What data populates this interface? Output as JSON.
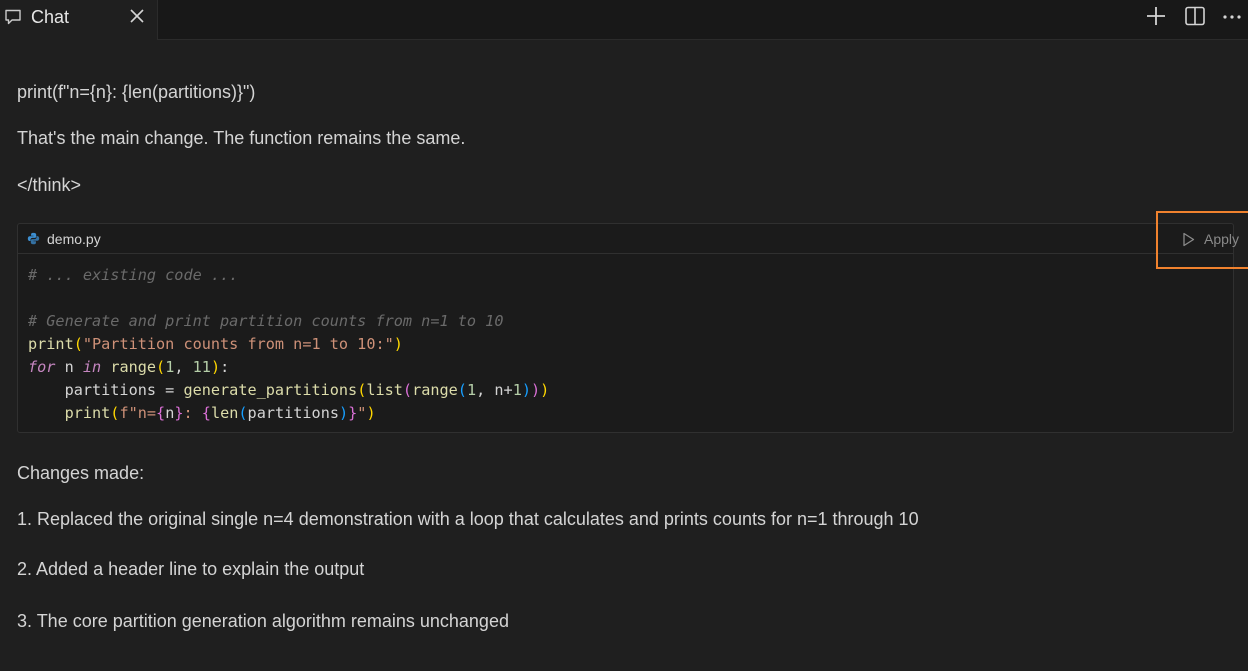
{
  "tab": {
    "label": "Chat"
  },
  "toolbar": {
    "icons": [
      "plus-icon",
      "split-editor-icon",
      "more-icon"
    ]
  },
  "message": {
    "line1": "print(f\"n={n}: {len(partitions)}\")",
    "line2": "That's the main change. The function remains the same.",
    "line3": "</think>",
    "changes_heading": "Changes made:",
    "changes": [
      "1. Replaced the original single n=4 demonstration with a loop that calculates and prints counts for n=1 through 10",
      "2. Added a header line to explain the output",
      "3. The core partition generation algorithm remains unchanged"
    ]
  },
  "codeblock": {
    "filename": "demo.py",
    "apply_label": "Apply",
    "lines": [
      {
        "tokens": [
          {
            "t": "# ... existing code ...",
            "c": "comment"
          }
        ]
      },
      {
        "tokens": []
      },
      {
        "tokens": [
          {
            "t": "# Generate and print partition counts from n=1 to 10",
            "c": "comment"
          }
        ]
      },
      {
        "tokens": [
          {
            "t": "print",
            "c": "fn"
          },
          {
            "t": "(",
            "c": "b1"
          },
          {
            "t": "\"Partition counts from n=1 to 10:\"",
            "c": "str"
          },
          {
            "t": ")",
            "c": "b1"
          }
        ]
      },
      {
        "tokens": [
          {
            "t": "for",
            "c": "kw"
          },
          {
            "t": " n ",
            "c": "plain"
          },
          {
            "t": "in",
            "c": "kw"
          },
          {
            "t": " ",
            "c": "plain"
          },
          {
            "t": "range",
            "c": "fn"
          },
          {
            "t": "(",
            "c": "b1"
          },
          {
            "t": "1",
            "c": "num"
          },
          {
            "t": ", ",
            "c": "plain"
          },
          {
            "t": "11",
            "c": "num"
          },
          {
            "t": ")",
            "c": "b1"
          },
          {
            "t": ":",
            "c": "plain"
          }
        ]
      },
      {
        "tokens": [
          {
            "t": "    partitions = ",
            "c": "plain"
          },
          {
            "t": "generate_partitions",
            "c": "fn"
          },
          {
            "t": "(",
            "c": "b1"
          },
          {
            "t": "list",
            "c": "fn"
          },
          {
            "t": "(",
            "c": "b2"
          },
          {
            "t": "range",
            "c": "fn"
          },
          {
            "t": "(",
            "c": "b3"
          },
          {
            "t": "1",
            "c": "num"
          },
          {
            "t": ", n+",
            "c": "plain"
          },
          {
            "t": "1",
            "c": "num"
          },
          {
            "t": ")",
            "c": "b3"
          },
          {
            "t": ")",
            "c": "b2"
          },
          {
            "t": ")",
            "c": "b1"
          }
        ]
      },
      {
        "tokens": [
          {
            "t": "    ",
            "c": "plain"
          },
          {
            "t": "print",
            "c": "fn"
          },
          {
            "t": "(",
            "c": "b1"
          },
          {
            "t": "f\"n=",
            "c": "str"
          },
          {
            "t": "{",
            "c": "b2"
          },
          {
            "t": "n",
            "c": "plain"
          },
          {
            "t": "}",
            "c": "b2"
          },
          {
            "t": ": ",
            "c": "str"
          },
          {
            "t": "{",
            "c": "b2"
          },
          {
            "t": "len",
            "c": "fn"
          },
          {
            "t": "(",
            "c": "b3"
          },
          {
            "t": "partitions",
            "c": "plain"
          },
          {
            "t": ")",
            "c": "b3"
          },
          {
            "t": "}",
            "c": "b2"
          },
          {
            "t": "\"",
            "c": "str"
          },
          {
            "t": ")",
            "c": "b1"
          }
        ]
      }
    ]
  },
  "colors": {
    "apply_highlight": "#f0822e",
    "background": "#1f1f1f"
  }
}
